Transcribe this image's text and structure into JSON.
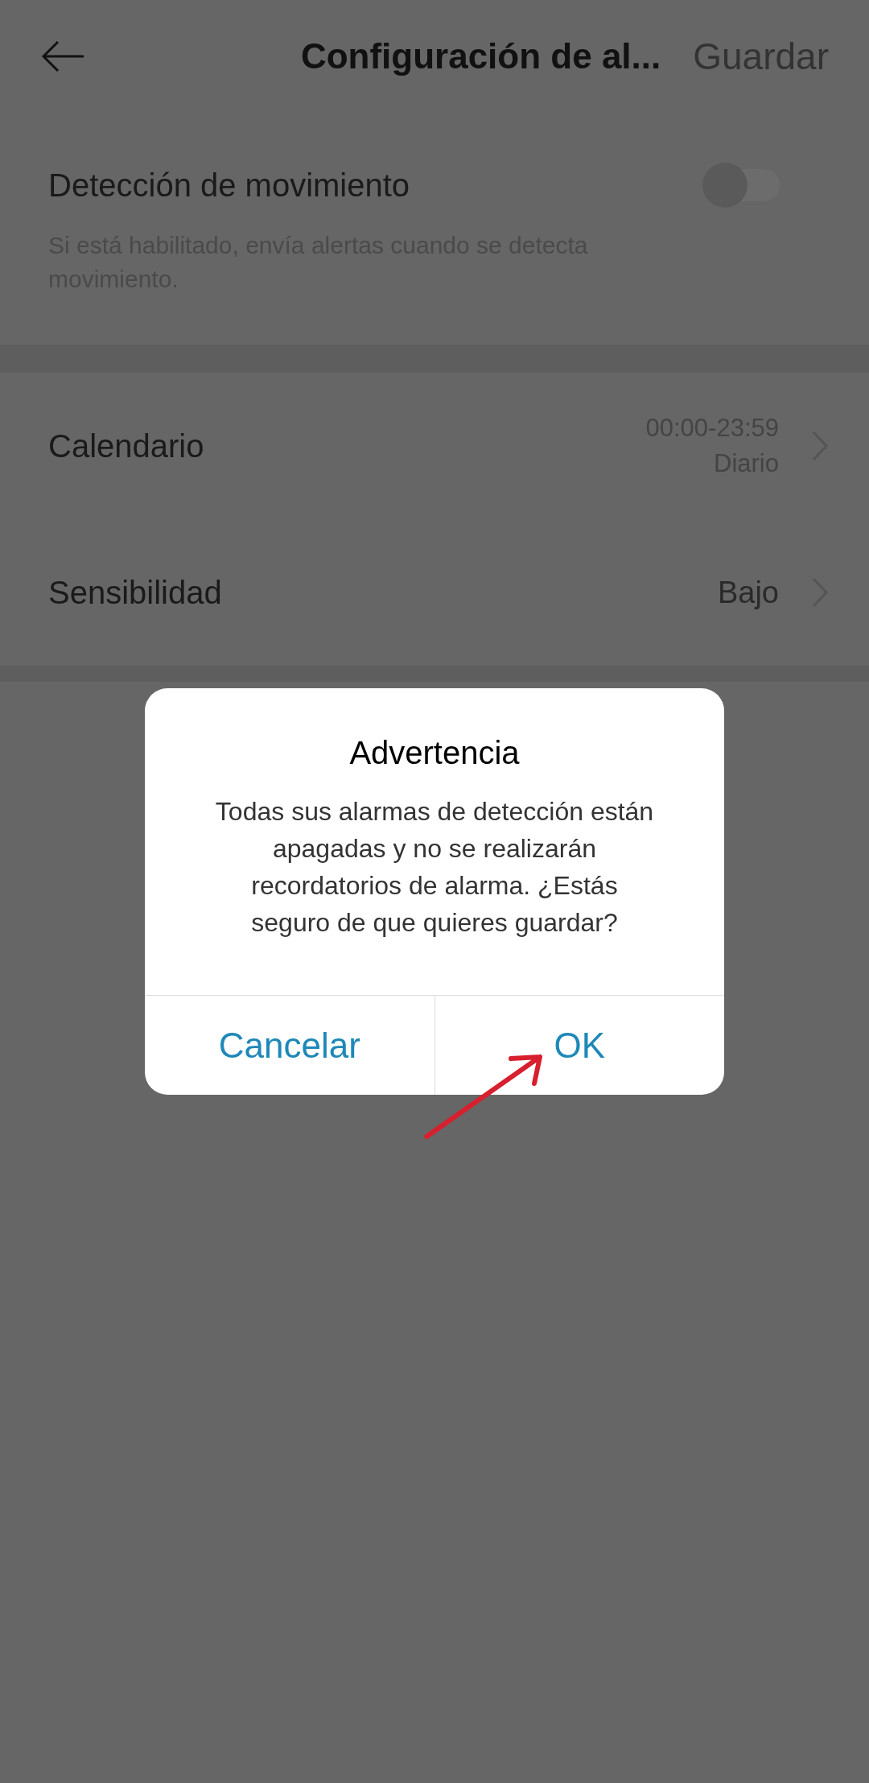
{
  "header": {
    "title": "Configuración de al...",
    "action": "Guardar"
  },
  "motion_detection": {
    "label": "Detección de movimiento",
    "on": false,
    "description": "Si está habilitado, envía alertas cuando se detecta movimiento."
  },
  "settings": [
    {
      "label": "Calendario",
      "values": [
        "00:00-23:59",
        "Diario"
      ]
    },
    {
      "label": "Sensibilidad",
      "values": [
        "Bajo"
      ]
    }
  ],
  "dialog": {
    "title": "Advertencia",
    "message": "Todas sus alarmas de detección están apagadas y no se realizarán recordatorios de alarma. ¿Estás seguro de que quieres guardar?",
    "buttons": [
      "Cancelar",
      "OK"
    ]
  }
}
